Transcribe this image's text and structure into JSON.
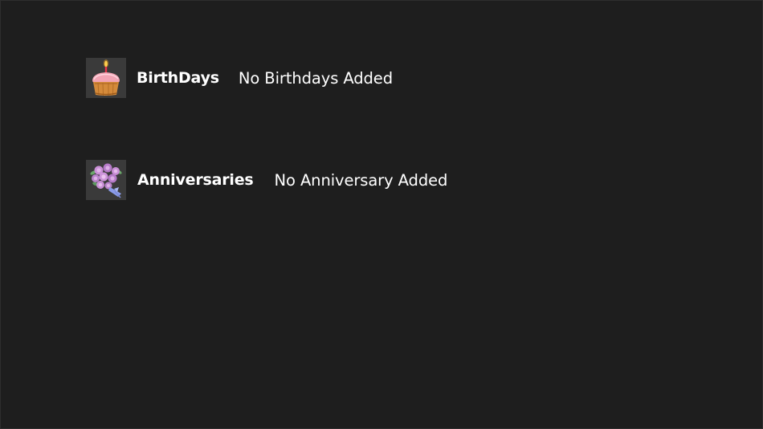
{
  "sections": [
    {
      "key": "birthdays",
      "icon": "cupcake-icon",
      "title": "BirthDays",
      "status": "No Birthdays Added"
    },
    {
      "key": "anniversaries",
      "icon": "flower-bouquet-icon",
      "title": "Anniversaries",
      "status": "No Anniversary Added"
    }
  ],
  "colors": {
    "background": "#1e1e1e",
    "tile": "#3a3a3a",
    "text": "#ffffff"
  }
}
